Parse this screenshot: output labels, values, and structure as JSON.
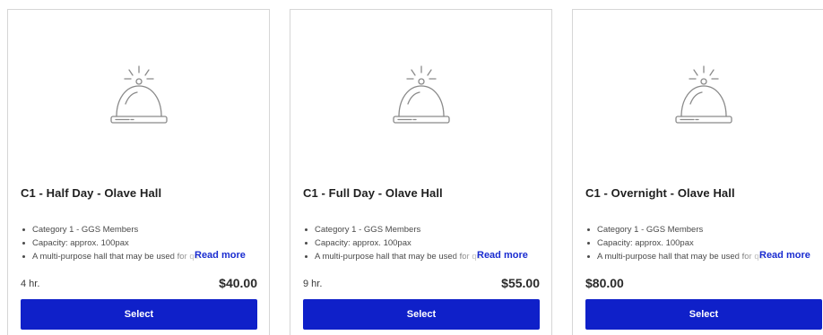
{
  "cards": [
    {
      "icon": "service-bell-icon",
      "title": "C1 - Half Day - Olave Hall",
      "features": [
        "Category 1 - GGS Members",
        "Capacity: approx. 100pax",
        "A multi-purpose hall that may be used for qu"
      ],
      "read_more": "Read more",
      "duration": "4 hr.",
      "price": "$40.00",
      "select_label": "Select"
    },
    {
      "icon": "service-bell-icon",
      "title": "C1 - Full Day - Olave Hall",
      "features": [
        "Category 1 - GGS Members",
        "Capacity: approx. 100pax",
        "A multi-purpose hall that may be used for qu"
      ],
      "read_more": "Read more",
      "duration": "9 hr.",
      "price": "$55.00",
      "select_label": "Select"
    },
    {
      "icon": "service-bell-icon",
      "title": "C1 - Overnight - Olave Hall",
      "features": [
        "Category 1 - GGS Members",
        "Capacity: approx. 100pax",
        "A multi-purpose hall that may be used for qu"
      ],
      "read_more": "Read more",
      "duration": "",
      "price": "$80.00",
      "select_label": "Select"
    }
  ],
  "colors": {
    "accent": "#0f20c9",
    "link": "#1a2cd0",
    "border": "#d6d6d6",
    "icon_stroke": "#8a8a8a"
  }
}
